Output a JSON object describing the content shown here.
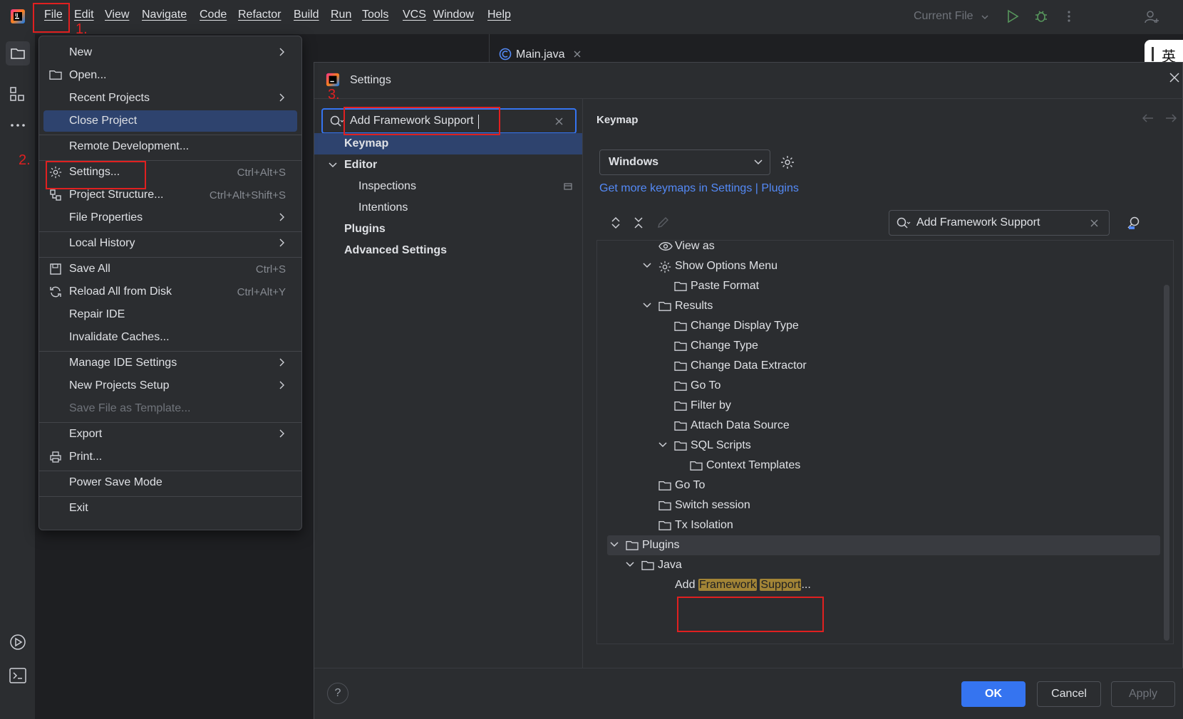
{
  "menubar": {
    "items": [
      "File",
      "Edit",
      "View",
      "Navigate",
      "Code",
      "Refactor",
      "Build",
      "Run",
      "Tools",
      "VCS",
      "Window",
      "Help"
    ],
    "run_config": "Current File"
  },
  "editor": {
    "tab_label": "Main.java"
  },
  "ime": {
    "label": "英"
  },
  "file_menu": {
    "items": [
      {
        "label": "New",
        "shortcut": "",
        "submenu": true
      },
      {
        "label": "Open...",
        "shortcut": "",
        "submenu": false
      },
      {
        "label": "Recent Projects",
        "shortcut": "",
        "submenu": true
      },
      {
        "label": "Close Project",
        "shortcut": "",
        "submenu": false
      },
      {
        "label": "Remote Development...",
        "shortcut": "",
        "submenu": false
      },
      {
        "label": "Settings...",
        "shortcut": "Ctrl+Alt+S",
        "submenu": false
      },
      {
        "label": "Project Structure...",
        "shortcut": "Ctrl+Alt+Shift+S",
        "submenu": false
      },
      {
        "label": "File Properties",
        "shortcut": "",
        "submenu": true
      },
      {
        "label": "Local History",
        "shortcut": "",
        "submenu": true
      },
      {
        "label": "Save All",
        "shortcut": "Ctrl+S",
        "submenu": false
      },
      {
        "label": "Reload All from Disk",
        "shortcut": "Ctrl+Alt+Y",
        "submenu": false
      },
      {
        "label": "Repair IDE",
        "shortcut": "",
        "submenu": false
      },
      {
        "label": "Invalidate Caches...",
        "shortcut": "",
        "submenu": false
      },
      {
        "label": "Manage IDE Settings",
        "shortcut": "",
        "submenu": true
      },
      {
        "label": "New Projects Setup",
        "shortcut": "",
        "submenu": true
      },
      {
        "label": "Save File as Template...",
        "shortcut": "",
        "submenu": false
      },
      {
        "label": "Export",
        "shortcut": "",
        "submenu": true
      },
      {
        "label": "Print...",
        "shortcut": "",
        "submenu": false
      },
      {
        "label": "Power Save Mode",
        "shortcut": "",
        "submenu": false
      },
      {
        "label": "Exit",
        "shortcut": "",
        "submenu": false
      }
    ]
  },
  "settings": {
    "title": "Settings",
    "search_value": "Add Framework Support",
    "nav": [
      "Keymap",
      "Editor",
      "Inspections",
      "Intentions",
      "Plugins",
      "Advanced Settings"
    ],
    "breadcrumb": "Keymap",
    "keymap_scheme": "Windows",
    "keymap_link": "Get more keymaps in Settings | Plugins",
    "filter_value": "Add Framework Support",
    "tree": [
      "View as",
      "Show Options Menu",
      "Paste Format",
      "Results",
      "Change Display Type",
      "Change Type",
      "Change Data Extractor",
      "Go To",
      "Filter by",
      "Attach Data Source",
      "SQL Scripts",
      "Context Templates",
      "Go To",
      "Switch session",
      "Tx Isolation",
      "Plugins",
      "Java"
    ],
    "result": {
      "prefix": "Add",
      "word1": "Framework",
      "word2": "Support",
      "suffix": "..."
    },
    "buttons": {
      "ok": "OK",
      "cancel": "Cancel",
      "apply": "Apply",
      "help": "?"
    }
  },
  "annotations": {
    "step1": "1.",
    "step2": "2.",
    "step3": "3."
  },
  "colors": {
    "accent": "#3574f0",
    "selection": "#2e436e",
    "annotation": "#e02020",
    "match_highlight": "#a28436",
    "link": "#548af7"
  }
}
